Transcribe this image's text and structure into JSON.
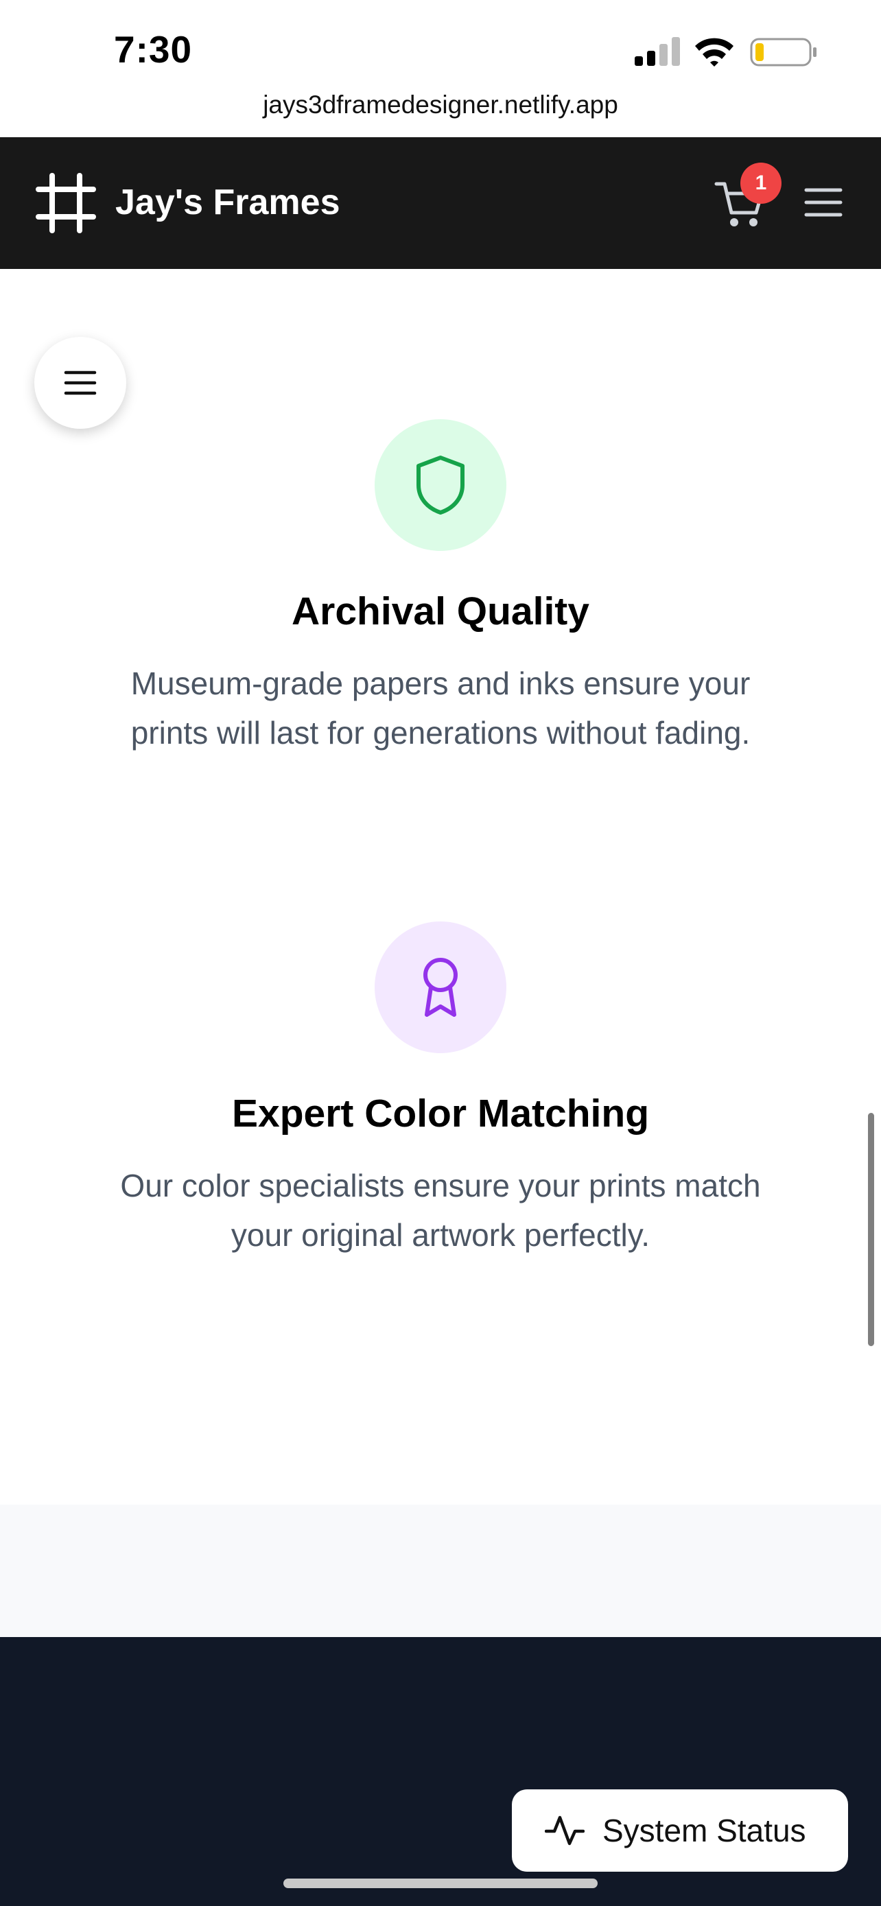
{
  "status_bar": {
    "time": "7:30",
    "battery_level": 0.15
  },
  "browser": {
    "url": "jays3dframedesigner.netlify.app"
  },
  "header": {
    "brand": "Jay's Frames",
    "cart_count": "1",
    "logo_icon": "frame-hash-icon",
    "cart_icon": "cart-icon",
    "menu_icon": "hamburger-icon"
  },
  "floating_menu": {
    "icon": "hamburger-icon"
  },
  "features": [
    {
      "icon": "shield-icon",
      "title": "Archival Quality",
      "description": "Museum-grade papers and inks ensure your prints will last for generations without fading.",
      "icon_bg": "#dcfce7",
      "icon_color": "#16a34a"
    },
    {
      "icon": "award-ribbon-icon",
      "title": "Expert Color Matching",
      "description": "Our color specialists ensure your prints match your original artwork perfectly.",
      "icon_bg": "#f3e8ff",
      "icon_color": "#9333ea"
    }
  ],
  "system_status": {
    "label": "System Status",
    "icon": "activity-pulse-icon"
  },
  "colors": {
    "header_bg": "#181818",
    "footer_bg": "#111827",
    "badge": "#ef4444",
    "text_muted": "#4b5563"
  }
}
